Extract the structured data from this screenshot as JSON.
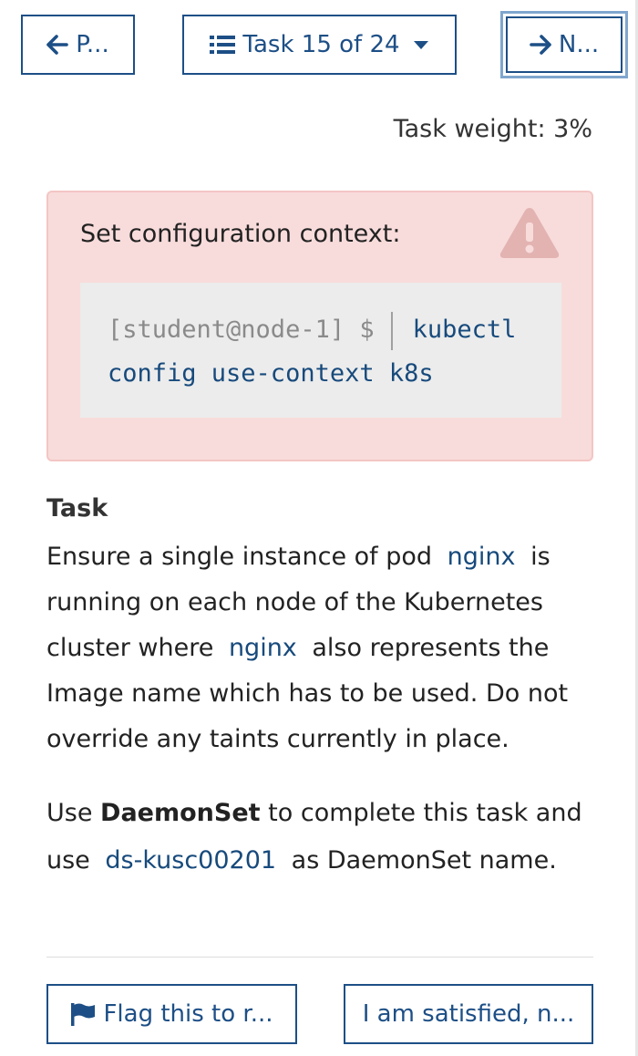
{
  "nav": {
    "prev_label": "P...",
    "tasks_label": "Task 15 of 24",
    "next_label": "N..."
  },
  "task_weight": "Task weight: 3%",
  "context": {
    "title": "Set configuration context:",
    "prompt": "[student@node-1] $",
    "command_line1": "kubectl",
    "command_line2": "config use-context k8s"
  },
  "task": {
    "heading": "Task",
    "p1_part1": "Ensure a single instance of pod",
    "p1_code1": "nginx",
    "p1_part2": "is running on each node of the Kubernetes cluster where",
    "p1_code2": "nginx",
    "p1_part3": "also represents the Image name which has to be used. Do not override any taints currently in place.",
    "p2_part1": "Use",
    "p2_bold": "DaemonSet",
    "p2_part2": "to complete this task and use",
    "p2_code": "ds-kusc00201",
    "p2_part3": "as DaemonSet name."
  },
  "footer": {
    "flag_label": "Flag this to r...",
    "satisfied_label": "I am satisfied, n..."
  },
  "colors": {
    "primary": "#1d4f86",
    "alert_bg": "#f8dcdb",
    "code_bg": "#ececec"
  },
  "icons": [
    "arrow-left-icon",
    "list-icon",
    "caret-down-icon",
    "arrow-right-icon",
    "warning-icon",
    "flag-icon"
  ]
}
